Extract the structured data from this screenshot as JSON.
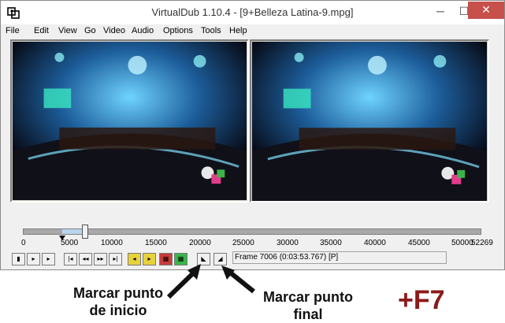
{
  "window": {
    "title": "VirtualDub 1.10.4 - [9+Belleza Latina-9.mpg]"
  },
  "titlebar_buttons": {
    "minimize": "─",
    "maximize": "☐",
    "close": "✕"
  },
  "menu": [
    "File",
    "Edit",
    "View",
    "Go",
    "Video",
    "Audio",
    "Options",
    "Tools",
    "Help"
  ],
  "timeline": {
    "ticks": [
      "0",
      "5000",
      "10000",
      "15000",
      "20000",
      "25000",
      "30000",
      "35000",
      "40000",
      "45000",
      "50000",
      "52269"
    ],
    "current_frame": 7006,
    "total_frames": 52269
  },
  "status": {
    "frame_text": "Frame 7006 (0:03:53.767) [P]"
  },
  "annotations": {
    "mark_start_line1": "Marcar punto",
    "mark_start_line2": "de inicio",
    "mark_end_line1": "Marcar punto",
    "mark_end_line2": "final",
    "shortcut": "+F7"
  },
  "colors": {
    "close_button": "#c7504b",
    "shortcut_text": "#8b1a1a"
  }
}
